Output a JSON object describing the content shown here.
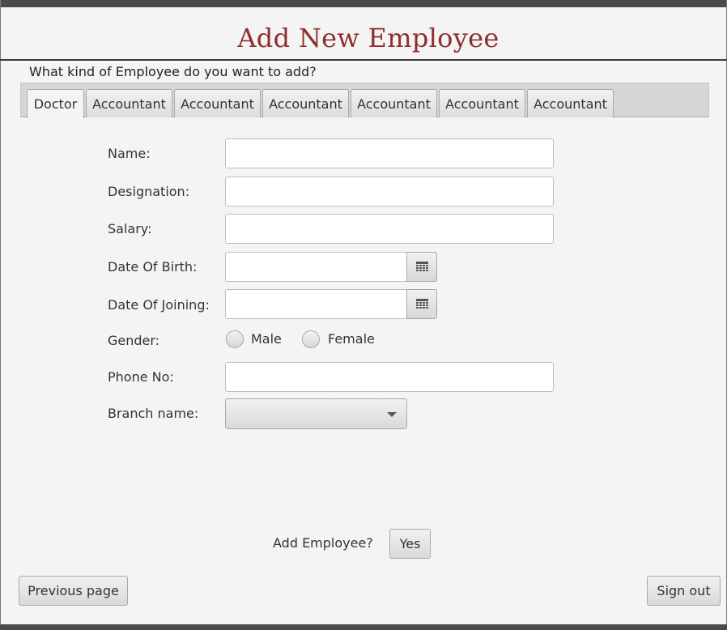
{
  "header": {
    "title": "Add New Employee",
    "question": "What kind of Employee do you want to add?"
  },
  "tabs": [
    {
      "label": "Doctor",
      "active": true
    },
    {
      "label": "Accountant",
      "active": false
    },
    {
      "label": "Accountant",
      "active": false
    },
    {
      "label": "Accountant",
      "active": false
    },
    {
      "label": "Accountant",
      "active": false
    },
    {
      "label": "Accountant",
      "active": false
    },
    {
      "label": "Accountant",
      "active": false
    }
  ],
  "form": {
    "name_label": "Name:",
    "name_value": "",
    "designation_label": "Designation:",
    "designation_value": "",
    "salary_label": "Salary:",
    "salary_value": "",
    "dob_label": "Date Of Birth:",
    "dob_value": "",
    "doj_label": "Date Of Joining:",
    "doj_value": "",
    "gender_label": "Gender:",
    "gender_options": [
      "Male",
      "Female"
    ],
    "phone_label": "Phone No:",
    "phone_value": "",
    "branch_label": "Branch name:",
    "branch_selected": "",
    "calendar_icon": "calendar-icon",
    "dropdown_icon": "chevron-down-icon"
  },
  "actions": {
    "add_prompt": "Add Employee?",
    "yes_label": "Yes",
    "previous_label": "Previous page",
    "signout_label": "Sign out"
  },
  "colors": {
    "title": "#8b2f2b",
    "background": "#f4f4f4"
  }
}
